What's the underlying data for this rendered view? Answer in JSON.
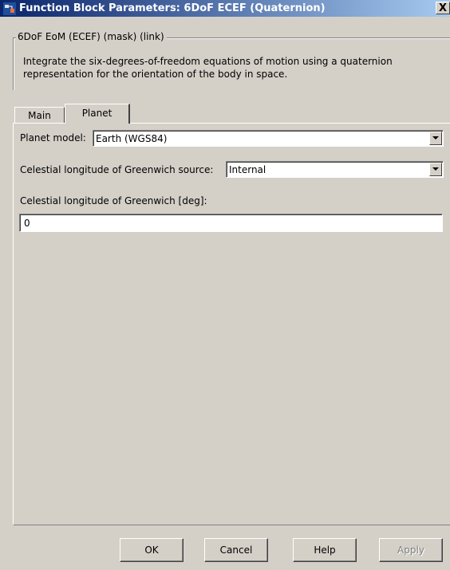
{
  "window": {
    "title": "Function Block Parameters: 6DoF ECEF (Quaternion)",
    "close_label": "X",
    "icon": "simulink-block-icon"
  },
  "mask": {
    "group_label": "6DoF EoM (ECEF) (mask) (link)",
    "description": "Integrate the six-degrees-of-freedom equations of motion using a quaternion representation for the orientation of the body in space."
  },
  "tabs": [
    {
      "label": "Main",
      "active": false
    },
    {
      "label": "Planet",
      "active": true
    }
  ],
  "planet": {
    "planet_model_label": "Planet model:",
    "planet_model_value": "Earth (WGS84)",
    "celestial_source_label": "Celestial longitude of Greenwich source:",
    "celestial_source_value": "Internal",
    "celestial_longitude_label": "Celestial longitude of Greenwich [deg]:",
    "celestial_longitude_value": "0"
  },
  "buttons": {
    "ok": "OK",
    "cancel": "Cancel",
    "help": "Help",
    "apply": "Apply"
  },
  "colors": {
    "titlebar_start": "#0a246a",
    "titlebar_end": "#a6caf0",
    "face": "#d4d0c8"
  }
}
